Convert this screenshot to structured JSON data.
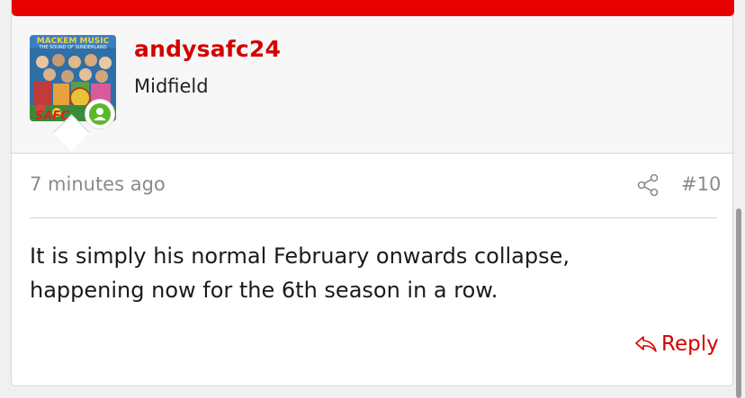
{
  "colors": {
    "accent": "#d40000",
    "top_bar": "#e60000",
    "online": "#5cb82a"
  },
  "avatar": {
    "text_top": "MACKEM MUSIC",
    "text_sub": "THE SOUND OF SUNDERLAND",
    "text_bottom": "SAFC"
  },
  "user": {
    "name": "andysafc24",
    "title": "Midfield"
  },
  "post": {
    "timestamp": "7 minutes ago",
    "number": "#10",
    "message_line1": "It is simply his normal February onwards collapse,",
    "message_line2": "happening now for the 6th season in a row.",
    "reply_label": "Reply"
  },
  "icons": {
    "share": "share-icon",
    "reply": "reply-arrow-icon",
    "online": "user-online-icon"
  }
}
